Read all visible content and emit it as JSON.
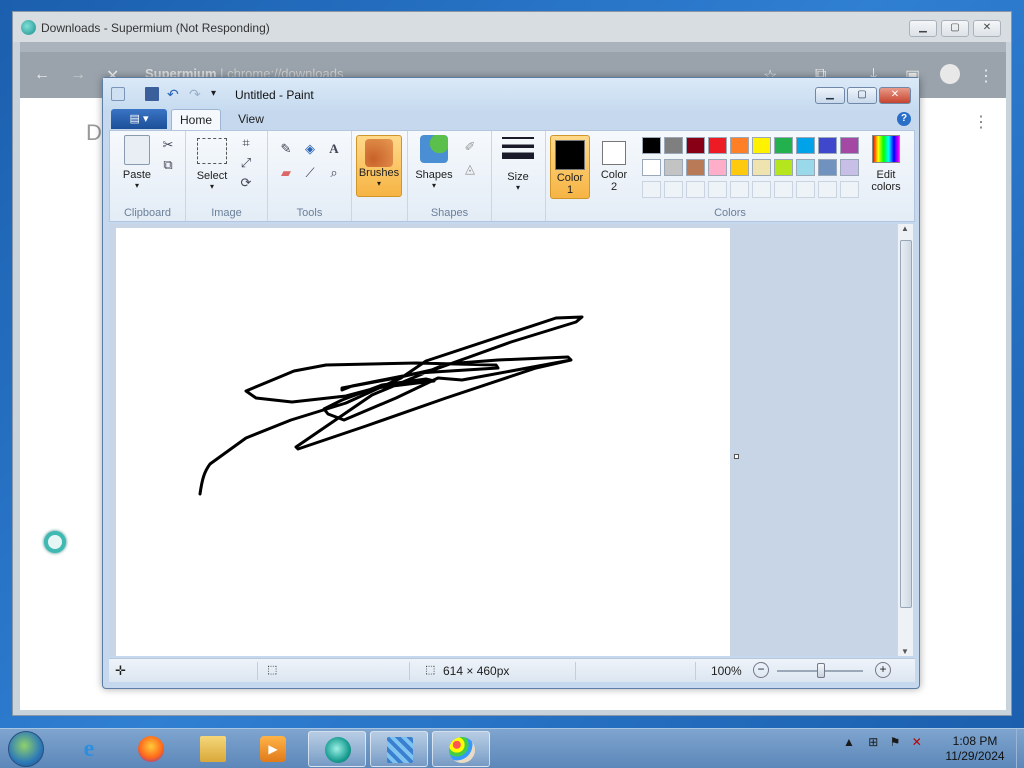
{
  "browser": {
    "title": "Downloads - Supermium (Not Responding)",
    "address_host": "Supermium",
    "address_sep": " | ",
    "address_url": "chrome://downloads",
    "page_heading_fragment": "D"
  },
  "paint": {
    "title": "Untitled - Paint",
    "tabs": {
      "home": "Home",
      "view": "View"
    },
    "groups": {
      "clipboard": "Clipboard",
      "image": "Image",
      "tools": "Tools",
      "shapes": "Shapes",
      "colors": "Colors"
    },
    "buttons": {
      "paste": "Paste",
      "select": "Select",
      "brushes": "Brushes",
      "shapes": "Shapes",
      "size": "Size",
      "color1": "Color 1",
      "color2": "Color 2",
      "edit_colors_1": "Edit",
      "edit_colors_2": "colors"
    },
    "palette_row1": [
      "#000000",
      "#7f7f7f",
      "#880015",
      "#ed1c24",
      "#ff7f27",
      "#fff200",
      "#22b14c",
      "#00a2e8",
      "#3f48cc",
      "#a349a4"
    ],
    "palette_row2": [
      "#ffffff",
      "#c3c3c3",
      "#b97a57",
      "#ffaec9",
      "#ffc90e",
      "#efe4b0",
      "#b5e61d",
      "#99d9ea",
      "#7092be",
      "#c8bfe7"
    ],
    "color1_value": "#000000",
    "color2_value": "#ffffff",
    "status": {
      "canvas_size": "614 × 460px",
      "zoom": "100%"
    }
  },
  "taskbar": {
    "time": "1:08 PM",
    "date": "11/29/2024"
  }
}
